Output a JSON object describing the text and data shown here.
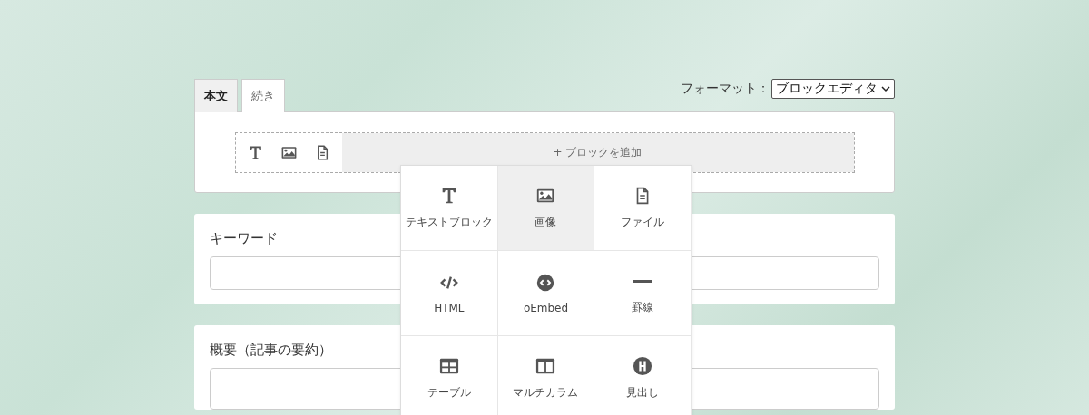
{
  "tabs": [
    {
      "label": "本文",
      "selected": true
    },
    {
      "label": "続き",
      "selected": false
    }
  ],
  "format": {
    "label": "フォーマット：",
    "value": "ブロックエディタ"
  },
  "editor": {
    "quick_icons": [
      {
        "kind": "text"
      },
      {
        "kind": "image"
      },
      {
        "kind": "file"
      }
    ],
    "add_button": "+ ブロックを追加"
  },
  "block_menu": [
    {
      "kind": "text",
      "label": "テキストブロック",
      "highlighted": false
    },
    {
      "kind": "image",
      "label": "画像",
      "highlighted": true
    },
    {
      "kind": "file",
      "label": "ファイル",
      "highlighted": false
    },
    {
      "kind": "html",
      "label": "HTML",
      "highlighted": false
    },
    {
      "kind": "embed",
      "label": "oEmbed",
      "highlighted": false
    },
    {
      "kind": "rule",
      "label": "罫線",
      "highlighted": false
    },
    {
      "kind": "table",
      "label": "テーブル",
      "highlighted": false
    },
    {
      "kind": "columns",
      "label": "マルチカラム",
      "highlighted": false
    },
    {
      "kind": "heading",
      "label": "見出し",
      "highlighted": false
    }
  ],
  "fields": [
    {
      "label": "キーワード",
      "kind": "input"
    },
    {
      "label": "概要（記事の要約）",
      "kind": "textarea"
    }
  ]
}
